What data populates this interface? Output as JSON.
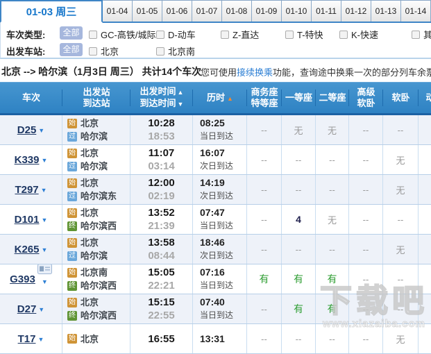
{
  "date_tabs": {
    "selected": "01-03 周三",
    "others": [
      "01-04",
      "01-05",
      "01-06",
      "01-07",
      "01-08",
      "01-09",
      "01-10",
      "01-11",
      "01-12",
      "01-13",
      "01-14"
    ]
  },
  "filters": [
    {
      "label": "车次类型:",
      "all_button": "全部",
      "options": [
        "GC-高铁/城际",
        "D-动车",
        "Z-直达",
        "T-特快",
        "K-快速",
        "其他"
      ],
      "positions": [
        127,
        224,
        317,
        410,
        488,
        592
      ]
    },
    {
      "label": "出发车站:",
      "all_button": "全部",
      "options": [
        "北京",
        "北京南"
      ],
      "positions": [
        127,
        224
      ]
    }
  ],
  "summary": {
    "route_text": "北京 --> 哈尔滨（1月3日  周三）",
    "count_text": " 共计14个车次",
    "tip_prefix": "您可使用",
    "tip_link": "接续换乘",
    "tip_suffix": "功能，查询途中换乘一次的部分列车余票情况"
  },
  "table": {
    "headers": {
      "train": "车次",
      "station_lines": [
        "出发站",
        "到达站"
      ],
      "time_lines": [
        "出发时间",
        "到达时间"
      ],
      "time_arrows": [
        "▲",
        "▼"
      ],
      "duration": "历时",
      "duration_arrow": "▲",
      "seat_columns": [
        [
          "商务座",
          "特等座"
        ],
        [
          "一等座"
        ],
        [
          "二等座"
        ],
        [
          "高级",
          "软卧"
        ],
        [
          "软卧"
        ],
        [
          "动卧"
        ]
      ]
    },
    "rows": [
      {
        "train": "D25",
        "id_icon": false,
        "from_badge": "始",
        "from": "北京",
        "to_badge": "过",
        "to": "哈尔滨",
        "dep": "10:28",
        "arr": "18:53",
        "dur": "08:25",
        "day": "当日到达",
        "seats": [
          "--",
          "无",
          "无",
          "--",
          "--",
          ""
        ]
      },
      {
        "train": "K339",
        "id_icon": false,
        "from_badge": "始",
        "from": "北京",
        "to_badge": "过",
        "to": "哈尔滨",
        "dep": "11:07",
        "arr": "03:14",
        "dur": "16:07",
        "day": "次日到达",
        "seats": [
          "--",
          "--",
          "--",
          "--",
          "无",
          ""
        ]
      },
      {
        "train": "T297",
        "id_icon": false,
        "from_badge": "始",
        "from": "北京",
        "to_badge": "过",
        "to": "哈尔滨东",
        "dep": "12:00",
        "arr": "02:19",
        "dur": "14:19",
        "day": "次日到达",
        "seats": [
          "--",
          "--",
          "--",
          "--",
          "无",
          ""
        ]
      },
      {
        "train": "D101",
        "id_icon": false,
        "from_badge": "始",
        "from": "北京",
        "to_badge": "终",
        "to": "哈尔滨西",
        "dep": "13:52",
        "arr": "21:39",
        "dur": "07:47",
        "day": "当日到达",
        "seats": [
          "--",
          "4",
          "无",
          "--",
          "--",
          ""
        ]
      },
      {
        "train": "K265",
        "id_icon": false,
        "from_badge": "始",
        "from": "北京",
        "to_badge": "过",
        "to": "哈尔滨",
        "dep": "13:58",
        "arr": "08:44",
        "dur": "18:46",
        "day": "次日到达",
        "seats": [
          "--",
          "--",
          "--",
          "--",
          "无",
          ""
        ]
      },
      {
        "train": "G393",
        "id_icon": true,
        "from_badge": "始",
        "from": "北京南",
        "to_badge": "终",
        "to": "哈尔滨西",
        "dep": "15:05",
        "arr": "22:21",
        "dur": "07:16",
        "day": "当日到达",
        "seats": [
          "有",
          "有",
          "有",
          "--",
          "--",
          ""
        ]
      },
      {
        "train": "D27",
        "id_icon": false,
        "from_badge": "始",
        "from": "北京",
        "to_badge": "终",
        "to": "哈尔滨西",
        "dep": "15:15",
        "arr": "22:55",
        "dur": "07:40",
        "day": "当日到达",
        "seats": [
          "--",
          "有",
          "有",
          "--",
          "--",
          ""
        ]
      },
      {
        "train": "T17",
        "id_icon": false,
        "from_badge": "始",
        "from": "北京",
        "to_badge": "",
        "to": "",
        "dep": "16:55",
        "arr": "",
        "dur": "13:31",
        "day": "",
        "seats": [
          "--",
          "--",
          "--",
          "--",
          "无",
          ""
        ]
      }
    ]
  },
  "colors": {
    "header_blue": "#3a8ccb",
    "selected_tab_blue": "#1777cb",
    "badge_start": "#cf9437",
    "badge_pass": "#6aa7da",
    "badge_end": "#5f9434",
    "available_green": "#2f9e33",
    "sort_active_orange": "#f5882e",
    "link_blue": "#2d7fd4"
  },
  "watermark": {
    "title": "下载吧",
    "url": "www.xiazaiba.com"
  }
}
